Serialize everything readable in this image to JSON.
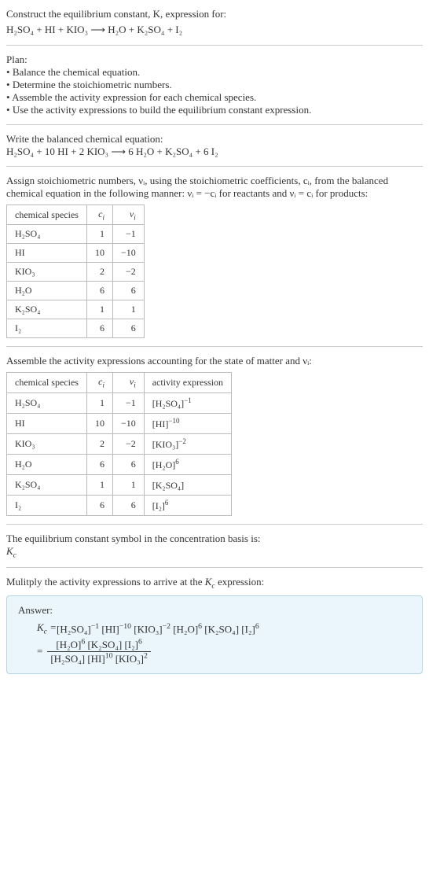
{
  "prompt": {
    "line1": "Construct the equilibrium constant, K, expression for:",
    "equation_lhs": "H₂SO₄ + HI + KIO₃",
    "arrow": "⟶",
    "equation_rhs": "H₂O + K₂SO₄ + I₂"
  },
  "plan": {
    "header": "Plan:",
    "items": [
      "Balance the chemical equation.",
      "Determine the stoichiometric numbers.",
      "Assemble the activity expression for each chemical species.",
      "Use the activity expressions to build the equilibrium constant expression."
    ]
  },
  "balanced": {
    "header": "Write the balanced chemical equation:",
    "lhs": "H₂SO₄ + 10 HI + 2 KIO₃",
    "arrow": "⟶",
    "rhs": "6 H₂O + K₂SO₄ + 6 I₂"
  },
  "stoich_text": {
    "part1": "Assign stoichiometric numbers, νᵢ, using the stoichiometric coefficients, cᵢ, from the balanced chemical equation in the following manner: νᵢ = −cᵢ for reactants and νᵢ = cᵢ for products:"
  },
  "table1": {
    "headers": [
      "chemical species",
      "cᵢ",
      "νᵢ"
    ],
    "rows": [
      [
        "H₂SO₄",
        "1",
        "−1"
      ],
      [
        "HI",
        "10",
        "−10"
      ],
      [
        "KIO₃",
        "2",
        "−2"
      ],
      [
        "H₂O",
        "6",
        "6"
      ],
      [
        "K₂SO₄",
        "1",
        "1"
      ],
      [
        "I₂",
        "6",
        "6"
      ]
    ]
  },
  "activity_header": "Assemble the activity expressions accounting for the state of matter and νᵢ:",
  "table2": {
    "headers": [
      "chemical species",
      "cᵢ",
      "νᵢ",
      "activity expression"
    ],
    "rows": [
      {
        "sp": "H₂SO₄",
        "c": "1",
        "v": "−1",
        "ae_base": "[H₂SO₄]",
        "ae_exp": "−1"
      },
      {
        "sp": "HI",
        "c": "10",
        "v": "−10",
        "ae_base": "[HI]",
        "ae_exp": "−10"
      },
      {
        "sp": "KIO₃",
        "c": "2",
        "v": "−2",
        "ae_base": "[KIO₃]",
        "ae_exp": "−2"
      },
      {
        "sp": "H₂O",
        "c": "6",
        "v": "6",
        "ae_base": "[H₂O]",
        "ae_exp": "6"
      },
      {
        "sp": "K₂SO₄",
        "c": "1",
        "v": "1",
        "ae_base": "[K₂SO₄]",
        "ae_exp": ""
      },
      {
        "sp": "I₂",
        "c": "6",
        "v": "6",
        "ae_base": "[I₂]",
        "ae_exp": "6"
      }
    ]
  },
  "kc_symbol": {
    "line1": "The equilibrium constant symbol in the concentration basis is:",
    "line2": "K𝒸"
  },
  "multiply": "Mulitply the activity expressions to arrive at the K𝒸 expression:",
  "answer": {
    "label": "Answer:",
    "lead": "K𝒸 = ",
    "inline_terms": [
      {
        "base": "[H₂SO₄]",
        "exp": "−1"
      },
      {
        "base": "[HI]",
        "exp": "−10"
      },
      {
        "base": "[KIO₃]",
        "exp": "−2"
      },
      {
        "base": "[H₂O]",
        "exp": "6"
      },
      {
        "base": "[K₂SO₄]",
        "exp": ""
      },
      {
        "base": "[I₂]",
        "exp": "6"
      }
    ],
    "eq": "= ",
    "num_terms": [
      {
        "base": "[H₂O]",
        "exp": "6"
      },
      {
        "base": "[K₂SO₄]",
        "exp": ""
      },
      {
        "base": "[I₂]",
        "exp": "6"
      }
    ],
    "den_terms": [
      {
        "base": "[H₂SO₄]",
        "exp": ""
      },
      {
        "base": "[HI]",
        "exp": "10"
      },
      {
        "base": "[KIO₃]",
        "exp": "2"
      }
    ]
  },
  "chart_data": {
    "type": "table",
    "tables": [
      {
        "title": "Stoichiometric numbers",
        "headers": [
          "chemical species",
          "c_i",
          "nu_i"
        ],
        "rows": [
          [
            "H2SO4",
            1,
            -1
          ],
          [
            "HI",
            10,
            -10
          ],
          [
            "KIO3",
            2,
            -2
          ],
          [
            "H2O",
            6,
            6
          ],
          [
            "K2SO4",
            1,
            1
          ],
          [
            "I2",
            6,
            6
          ]
        ]
      },
      {
        "title": "Activity expressions",
        "headers": [
          "chemical species",
          "c_i",
          "nu_i",
          "activity expression"
        ],
        "rows": [
          [
            "H2SO4",
            1,
            -1,
            "[H2SO4]^-1"
          ],
          [
            "HI",
            10,
            -10,
            "[HI]^-10"
          ],
          [
            "KIO3",
            2,
            -2,
            "[KIO3]^-2"
          ],
          [
            "H2O",
            6,
            6,
            "[H2O]^6"
          ],
          [
            "K2SO4",
            1,
            1,
            "[K2SO4]"
          ],
          [
            "I2",
            6,
            6,
            "[I2]^6"
          ]
        ]
      }
    ]
  }
}
